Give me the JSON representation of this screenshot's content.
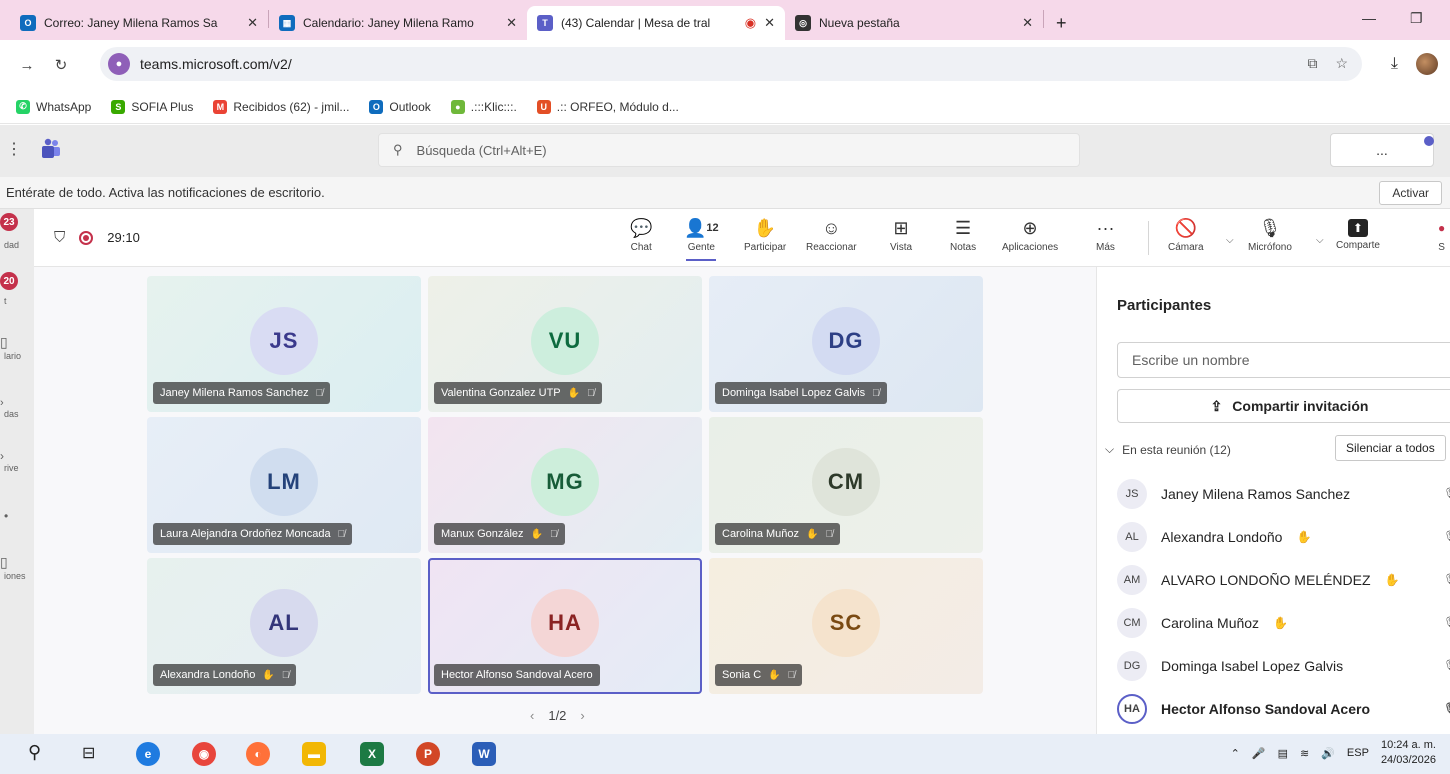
{
  "browser": {
    "tabs": [
      {
        "title": "Correo: Janey Milena Ramos Sa",
        "fav_color": "#0f6cbd",
        "fav": "O"
      },
      {
        "title": "Calendario: Janey Milena Ramo",
        "fav_color": "#0f6cbd",
        "fav": "▦"
      },
      {
        "title": "(43) Calendar | Mesa de tral",
        "fav_color": "#5b5fc7",
        "fav": "T"
      },
      {
        "title": "Nueva pestaña",
        "fav_color": "#333333",
        "fav": "◎"
      }
    ],
    "url": "teams.microsoft.com/v2/",
    "bookmarks": [
      {
        "label": "WhatsApp",
        "color": "#25d366",
        "glyph": "✆"
      },
      {
        "label": "SOFIA Plus",
        "color": "#39a900",
        "glyph": "S"
      },
      {
        "label": "Recibidos (62) - jmil...",
        "color": "#ea4335",
        "glyph": "M"
      },
      {
        "label": "Outlook",
        "color": "#0f6cbd",
        "glyph": "O"
      },
      {
        "label": ".:::Klic:::.",
        "color": "#6fb83a",
        "glyph": "●"
      },
      {
        "label": ".:: ORFEO, Módulo d...",
        "color": "#e34f26",
        "glyph": "U"
      }
    ]
  },
  "teams": {
    "search_placeholder": "Búsqueda (Ctrl+Alt+E)",
    "more_label": "...",
    "notification": "Entérate de todo. Activa las notificaciones de escritorio.",
    "activate_label": "Activar",
    "rail": [
      {
        "badge": "23",
        "label": "dad"
      },
      {
        "badge": "20",
        "label": "t"
      },
      {
        "badge": "",
        "label": "lario"
      },
      {
        "badge": "",
        "label": "das"
      },
      {
        "badge": "",
        "label": "rive"
      },
      {
        "badge": "",
        "label": "iones"
      }
    ]
  },
  "meeting": {
    "timer": "29:10",
    "controls": [
      {
        "label": "Chat",
        "icon": "chat-icon"
      },
      {
        "label": "Gente",
        "icon": "people-icon",
        "count": "12"
      },
      {
        "label": "Participar",
        "icon": "raise-hand-icon"
      },
      {
        "label": "Reaccionar",
        "icon": "react-icon"
      },
      {
        "label": "Vista",
        "icon": "view-icon"
      },
      {
        "label": "Notas",
        "icon": "notes-icon"
      },
      {
        "label": "Aplicaciones",
        "icon": "apps-icon"
      },
      {
        "label": "Más",
        "icon": "more-icon"
      },
      {
        "label": "Cámara",
        "icon": "camera-off-icon"
      },
      {
        "label": "Micrófono",
        "icon": "mic-off-icon"
      },
      {
        "label": "Comparte",
        "icon": "share-icon"
      },
      {
        "label": "S",
        "icon": "leave-icon"
      }
    ],
    "tiles": [
      {
        "initials": "JS",
        "name": "Janey Milena Ramos Sanchez",
        "av_bg": "#d9dcf3",
        "av_fg": "#3b3a8c",
        "bg": "linear-gradient(135deg,#e6f2ee,#dbeef2)",
        "hand": false,
        "muted": true
      },
      {
        "initials": "VU",
        "name": "Valentina Gonzalez UTP",
        "av_bg": "#cdeedd",
        "av_fg": "#0e6b3f",
        "bg": "linear-gradient(135deg,#eef0e8,#e3eef0)",
        "hand": true,
        "muted": true
      },
      {
        "initials": "DG",
        "name": "Dominga Isabel Lopez Galvis",
        "av_bg": "#d3dbf2",
        "av_fg": "#2d3f85",
        "bg": "linear-gradient(135deg,#e6edf6,#dde7f2)",
        "hand": false,
        "muted": true
      },
      {
        "initials": "LM",
        "name": "Laura Alejandra Ordoñez Moncada",
        "av_bg": "#d0ddef",
        "av_fg": "#24427a",
        "bg": "linear-gradient(135deg,#e7eef7,#dfe9f3)",
        "hand": false,
        "muted": true
      },
      {
        "initials": "MG",
        "name": "Manux González",
        "av_bg": "#cdeedb",
        "av_fg": "#175c38",
        "bg": "linear-gradient(135deg,#f3e4f0,#e3eef3)",
        "hand": true,
        "muted": true
      },
      {
        "initials": "CM",
        "name": "Carolina Muñoz",
        "av_bg": "#dfe4da",
        "av_fg": "#2e3a2a",
        "bg": "linear-gradient(135deg,#e9efe8,#edf0ea)",
        "hand": true,
        "muted": true
      },
      {
        "initials": "AL",
        "name": "Alexandra Londoño",
        "av_bg": "#d7daee",
        "av_fg": "#33357a",
        "bg": "linear-gradient(135deg,#e7f1ee,#e6edf4)",
        "hand": true,
        "muted": true
      },
      {
        "initials": "HA",
        "name": "Hector Alfonso Sandoval Acero",
        "av_bg": "#f4d6d6",
        "av_fg": "#8a2323",
        "bg": "linear-gradient(135deg,#f0e4f3,#e4ecf6)",
        "hand": false,
        "muted": false,
        "speaking": true
      },
      {
        "initials": "SC",
        "name": "Sonia C",
        "av_bg": "#f5e3cd",
        "av_fg": "#7a4a12",
        "bg": "linear-gradient(135deg,#f5eee0,#f3ece6)",
        "hand": true,
        "muted": true
      }
    ],
    "pager": "1/2"
  },
  "panel": {
    "title": "Participantes",
    "name_placeholder": "Escribe un nombre",
    "invite_label": "Compartir invitación",
    "section_label": "En esta reunión (12)",
    "mute_all_label": "Silenciar a todos",
    "participants": [
      {
        "initials": "JS",
        "name": "Janey Milena Ramos Sanchez",
        "hand": false
      },
      {
        "initials": "AL",
        "name": "Alexandra Londoño",
        "hand": true
      },
      {
        "initials": "AM",
        "name": "ALVARO LONDOÑO MELÉNDEZ",
        "hand": true
      },
      {
        "initials": "CM",
        "name": "Carolina Muñoz",
        "hand": true
      },
      {
        "initials": "DG",
        "name": "Dominga Isabel Lopez Galvis",
        "hand": false
      },
      {
        "initials": "HA",
        "name": "Hector Alfonso Sandoval Acero",
        "hand": false,
        "speaking": true
      }
    ]
  },
  "taskbar": {
    "lang": "ESP",
    "time": "10:24 a. m.",
    "date": "24/03/2026"
  }
}
